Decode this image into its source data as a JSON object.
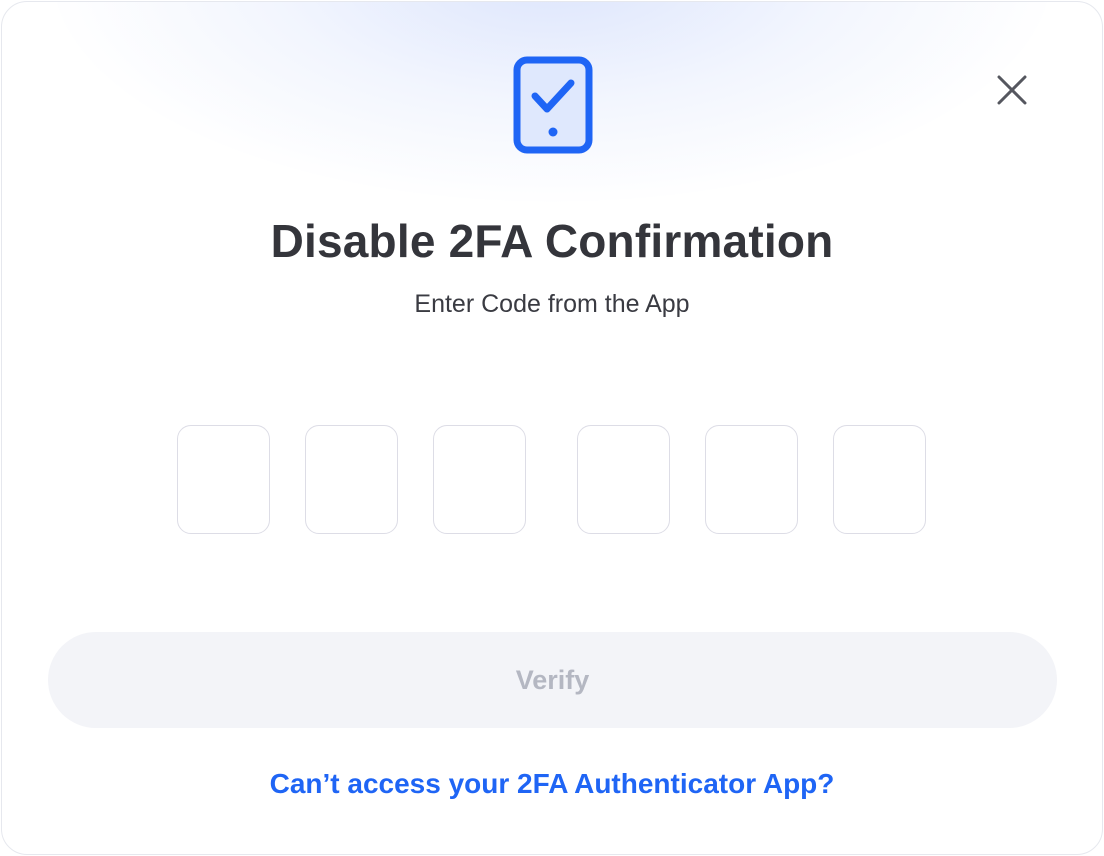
{
  "dialog": {
    "title": "Disable 2FA Confirmation",
    "subtitle": "Enter Code from the App",
    "code_fields": [
      {
        "value": "",
        "placeholder": ""
      },
      {
        "value": "",
        "placeholder": ""
      },
      {
        "value": "",
        "placeholder": ""
      },
      {
        "value": "",
        "placeholder": ""
      },
      {
        "value": "",
        "placeholder": ""
      },
      {
        "value": "",
        "placeholder": ""
      }
    ],
    "verify_label": "Verify",
    "help_link_label": "Can’t access your 2FA Authenticator App?",
    "icons": {
      "header": "phone-check-icon",
      "close": "close-icon"
    },
    "colors": {
      "accent": "#1f65f5",
      "button_disabled_bg": "#f3f4f8",
      "button_disabled_text": "#b4b7c2"
    }
  }
}
